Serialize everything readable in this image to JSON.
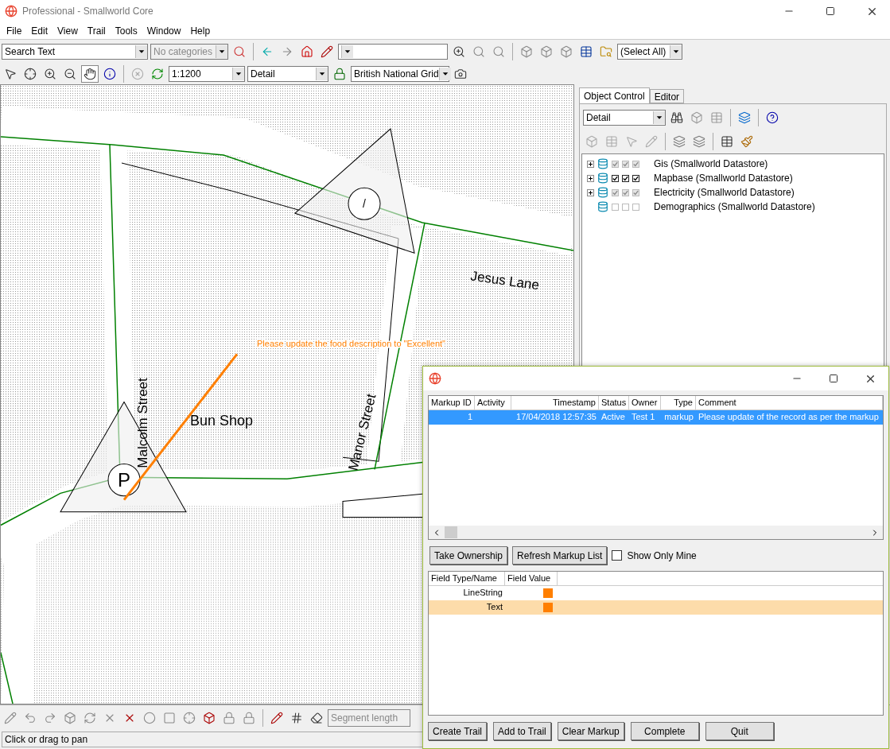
{
  "window": {
    "title": "Professional - Smallworld Core"
  },
  "menu": [
    "File",
    "Edit",
    "View",
    "Trail",
    "Tools",
    "Window",
    "Help"
  ],
  "toolbar": {
    "search": {
      "value": "Search Text"
    },
    "categories": {
      "value": "No categories",
      "disabled": true
    },
    "select": {
      "value": "(Select All)"
    }
  },
  "view_bar": {
    "scale": "1:1200",
    "detail": "Detail",
    "coordinate_system": "British National Grid",
    "pan_selected": true
  },
  "map": {
    "labels": [
      {
        "text": "Jesus Lane",
        "kind": "lane"
      },
      {
        "text": "Malcolm Street",
        "kind": "vertical"
      },
      {
        "text": "Manor Street",
        "kind": "slanted"
      },
      {
        "text": "Bun Shop",
        "kind": "shop"
      }
    ],
    "annotation": "Please update the food description to \"Excellent\"",
    "symbols": [
      {
        "text": "/",
        "kind": "top"
      },
      {
        "text": "P",
        "kind": "bottom"
      }
    ]
  },
  "object_control": {
    "tabs": [
      {
        "label": "Object Control",
        "selected": true
      },
      {
        "label": "Editor",
        "selected": false
      }
    ],
    "detail": "Detail",
    "datastores": [
      {
        "name": "Gis (Smallworld Datastore)",
        "expandable": true,
        "checked": true,
        "greyed": true
      },
      {
        "name": "Mapbase (Smallworld Datastore)",
        "expandable": true,
        "checked": true,
        "greyed": false
      },
      {
        "name": "Electricity (Smallworld Datastore)",
        "expandable": true,
        "checked": true,
        "greyed": true
      },
      {
        "name": "Demographics (Smallworld Datastore)",
        "expandable": false,
        "checked": false,
        "greyed": true
      }
    ]
  },
  "edit_bar": {
    "segment_length": {
      "placeholder": "Segment length"
    }
  },
  "status_bar": {
    "message": "Click or drag to pan"
  },
  "markup_dialog": {
    "columns": [
      "Markup ID",
      "Activity",
      "Timestamp",
      "Status",
      "Owner",
      "Type",
      "Comment"
    ],
    "rows": [
      {
        "cells": [
          "1",
          "",
          "17/04/2018 12:57:35",
          "Active",
          "Test 1",
          "markup",
          "Please update of the record as per the markup"
        ],
        "selected": true
      }
    ],
    "buttons": [
      "Take Ownership",
      "Refresh Markup List"
    ],
    "show_only_mine": {
      "label": "Show Only Mine",
      "checked": false
    },
    "fields": {
      "columns": [
        "Field Type/Name",
        "Field Value"
      ],
      "rows": [
        {
          "name": "LineString",
          "selected": false
        },
        {
          "name": "Text",
          "selected": true
        }
      ]
    },
    "actions": [
      "Create Trail",
      "Add to Trail",
      "Clear Markup",
      "Complete",
      "Quit"
    ]
  }
}
